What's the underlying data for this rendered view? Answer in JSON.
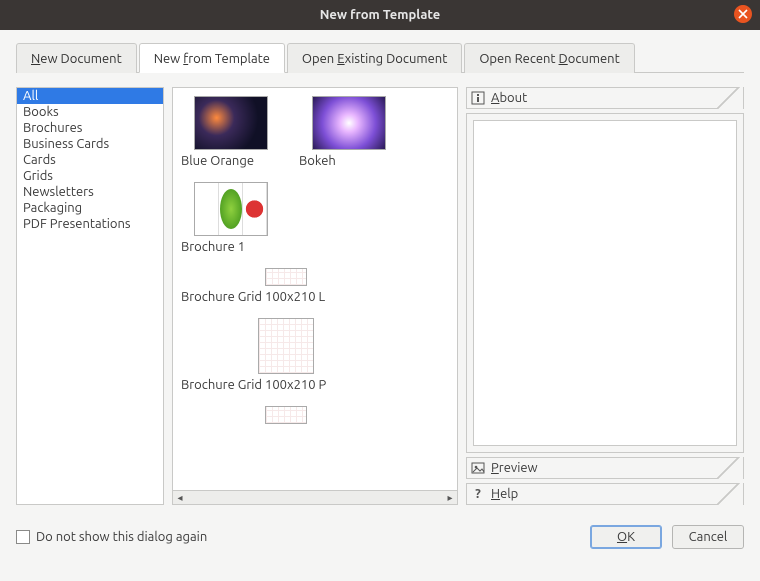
{
  "window": {
    "title": "New from Template"
  },
  "tabs": [
    {
      "label_pre": "",
      "accel": "N",
      "label_post": "ew Document"
    },
    {
      "label_pre": "New ",
      "accel": "f",
      "label_post": "rom Template"
    },
    {
      "label_pre": "Open ",
      "accel": "E",
      "label_post": "xisting Document"
    },
    {
      "label_pre": "Open Recent ",
      "accel": "D",
      "label_post": "ocument"
    }
  ],
  "active_tab_index": 1,
  "categories": [
    "All",
    "Books",
    "Brochures",
    "Business Cards",
    "Cards",
    "Grids",
    "Newsletters",
    "Packaging",
    "PDF Presentations"
  ],
  "selected_category_index": 0,
  "templates": [
    {
      "name": "Blue Orange",
      "thumb": "blue"
    },
    {
      "name": "Bokeh",
      "thumb": "bokeh"
    },
    {
      "name": "Brochure 1",
      "thumb": "broch1"
    },
    {
      "name": "Brochure Grid 100x210 L",
      "thumb": "small",
      "wide": true
    },
    {
      "name": "Brochure Grid 100x210 P",
      "thumb": "gridsq",
      "wide": true
    },
    {
      "name": "",
      "thumb": "small",
      "wide": true
    }
  ],
  "sections": {
    "about": {
      "label": "About",
      "accel": "A"
    },
    "preview": {
      "label": "Preview",
      "accel": "P"
    },
    "help": {
      "label": "Help",
      "accel": "H"
    }
  },
  "footer": {
    "checkbox_label": "Do not show this dialog again",
    "ok_pre": "O",
    "ok_accel": "K",
    "cancel": "Cancel"
  }
}
